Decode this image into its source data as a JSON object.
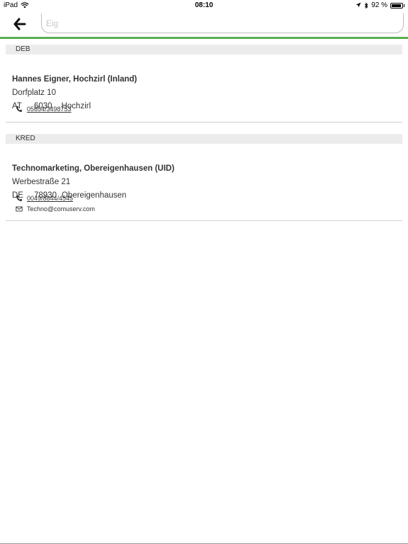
{
  "status_bar": {
    "device": "iPad",
    "time": "08:10",
    "battery": "92 %",
    "battery_level": 0.92
  },
  "toolbar": {
    "search_value": "",
    "search_placeholder": "Eig"
  },
  "results": [
    {
      "group": "DEB",
      "name": "Hannes Eigner, Hochzirl (Inland)",
      "street": "Dorfplatz 10",
      "country": "AT",
      "zip": "6030",
      "city": "Hochzirl",
      "phone": "05654/3498753",
      "email": ""
    },
    {
      "group": "KRED",
      "name": "Technomarketing, Obereigenhausen (UID)",
      "street": "Werbestraße 21",
      "country": "DE",
      "zip": "78930",
      "city": "Obereigenhausen",
      "phone": "0049/8844/4545",
      "email": "Techno@comuserv.com"
    }
  ],
  "colors": {
    "accent": "#5aae4f",
    "section_bg": "#ececec",
    "divider": "#cfcfcf"
  }
}
